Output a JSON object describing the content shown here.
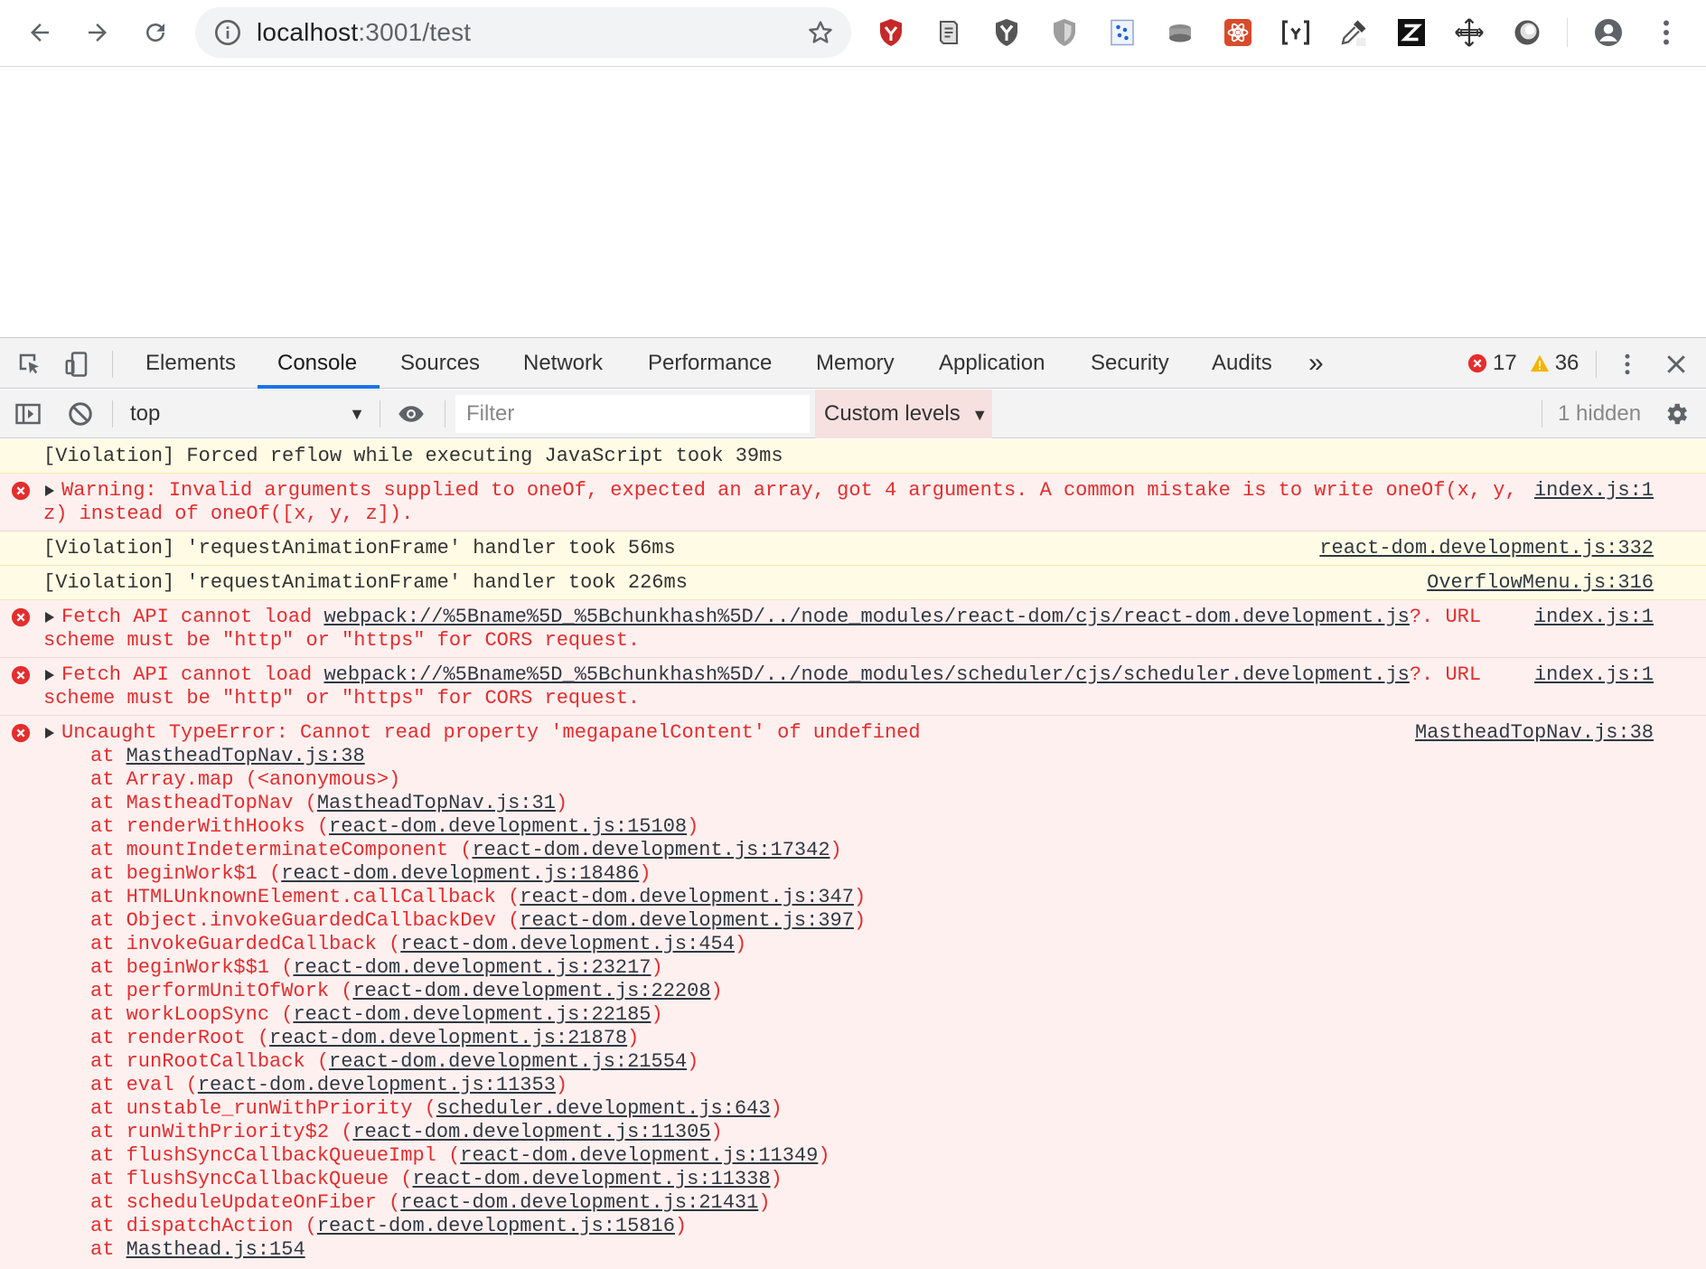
{
  "browser": {
    "url_host": "localhost",
    "url_path": ":3001/test",
    "extensions": [
      "brave-shield-icon",
      "scroll-icon",
      "y-shield-icon",
      "shield-icon",
      "dots-icon",
      "hat-icon",
      "react-icon",
      "bracket-icon",
      "eyedropper-icon",
      "z-icon",
      "move-icon",
      "circle-icon"
    ]
  },
  "devtools": {
    "tabs": [
      "Elements",
      "Console",
      "Sources",
      "Network",
      "Performance",
      "Memory",
      "Application",
      "Security",
      "Audits"
    ],
    "active_tab": "Console",
    "more_tabs": "»",
    "error_count": "17",
    "warning_count": "36",
    "context": "top",
    "filter_placeholder": "Filter",
    "levels_label": "Custom levels",
    "hidden_label": "1 hidden"
  },
  "console": {
    "m1": {
      "text": "[Violation] Forced reflow while executing JavaScript took 39ms"
    },
    "m2": {
      "line1": "Warning: Invalid arguments supplied to oneOf, expected an array, got 4 arguments. A common mistake is to write oneOf(x, y,",
      "line2": "z) instead of oneOf([x, y, z]).",
      "src": "index.js:1"
    },
    "m3": {
      "text": "[Violation] 'requestAnimationFrame' handler took 56ms",
      "src": "react-dom.development.js:332"
    },
    "m4": {
      "text": "[Violation] 'requestAnimationFrame' handler took 226ms",
      "src": "OverflowMenu.js:316"
    },
    "m5": {
      "prefix": "Fetch API cannot load ",
      "link": "webpack://%5Bname%5D_%5Bchunkhash%5D/../node_modules/react-dom/cjs/react-dom.development.js",
      "suffix": "?. URL",
      "line2": "scheme must be \"http\" or \"https\" for CORS request.",
      "src": "index.js:1"
    },
    "m6": {
      "prefix": "Fetch API cannot load ",
      "link": "webpack://%5Bname%5D_%5Bchunkhash%5D/../node_modules/scheduler/cjs/scheduler.development.js",
      "suffix": "?. URL",
      "line2": "scheme must be \"http\" or \"https\" for CORS request.",
      "src": "index.js:1"
    },
    "m7": {
      "text": "Uncaught TypeError: Cannot read property 'megapanelContent' of undefined",
      "src": "MastheadTopNav.js:38",
      "stack": [
        {
          "fn": "at ",
          "loc": "MastheadTopNav.js:38",
          "paren": false
        },
        {
          "fn": "at Array.map (<anonymous>)",
          "loc": "",
          "paren": false
        },
        {
          "fn": "at MastheadTopNav (",
          "loc": "MastheadTopNav.js:31",
          "paren": true
        },
        {
          "fn": "at renderWithHooks (",
          "loc": "react-dom.development.js:15108",
          "paren": true
        },
        {
          "fn": "at mountIndeterminateComponent (",
          "loc": "react-dom.development.js:17342",
          "paren": true
        },
        {
          "fn": "at beginWork$1 (",
          "loc": "react-dom.development.js:18486",
          "paren": true
        },
        {
          "fn": "at HTMLUnknownElement.callCallback (",
          "loc": "react-dom.development.js:347",
          "paren": true
        },
        {
          "fn": "at Object.invokeGuardedCallbackDev (",
          "loc": "react-dom.development.js:397",
          "paren": true
        },
        {
          "fn": "at invokeGuardedCallback (",
          "loc": "react-dom.development.js:454",
          "paren": true
        },
        {
          "fn": "at beginWork$$1 (",
          "loc": "react-dom.development.js:23217",
          "paren": true
        },
        {
          "fn": "at performUnitOfWork (",
          "loc": "react-dom.development.js:22208",
          "paren": true
        },
        {
          "fn": "at workLoopSync (",
          "loc": "react-dom.development.js:22185",
          "paren": true
        },
        {
          "fn": "at renderRoot (",
          "loc": "react-dom.development.js:21878",
          "paren": true
        },
        {
          "fn": "at runRootCallback (",
          "loc": "react-dom.development.js:21554",
          "paren": true
        },
        {
          "fn": "at eval (",
          "loc": "react-dom.development.js:11353",
          "paren": true
        },
        {
          "fn": "at unstable_runWithPriority (",
          "loc": "scheduler.development.js:643",
          "paren": true
        },
        {
          "fn": "at runWithPriority$2 (",
          "loc": "react-dom.development.js:11305",
          "paren": true
        },
        {
          "fn": "at flushSyncCallbackQueueImpl (",
          "loc": "react-dom.development.js:11349",
          "paren": true
        },
        {
          "fn": "at flushSyncCallbackQueue (",
          "loc": "react-dom.development.js:11338",
          "paren": true
        },
        {
          "fn": "at scheduleUpdateOnFiber (",
          "loc": "react-dom.development.js:21431",
          "paren": true
        },
        {
          "fn": "at dispatchAction (",
          "loc": "react-dom.development.js:15816",
          "paren": true
        },
        {
          "fn": "at ",
          "loc": "Masthead.js:154",
          "paren": false
        }
      ]
    }
  }
}
